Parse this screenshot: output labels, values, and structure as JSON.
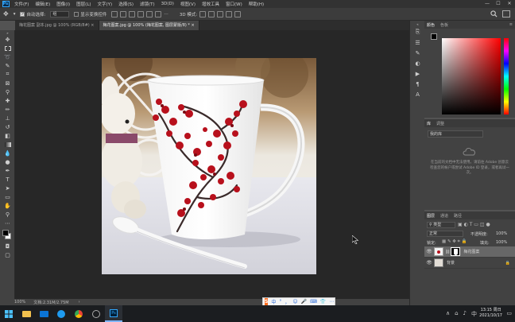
{
  "menubar": {
    "logo": "Ps",
    "items": [
      "文件(F)",
      "编辑(E)",
      "图像(I)",
      "图层(L)",
      "文字(Y)",
      "选择(S)",
      "滤镜(T)",
      "3D(D)",
      "视图(V)",
      "增效工具",
      "窗口(W)",
      "帮助(H)"
    ],
    "minimize": "—",
    "maximize": "☐",
    "close": "✕"
  },
  "optionsbar": {
    "auto_select_label": "自动选择:",
    "auto_select_value": "组",
    "show_transform_label": "显示变换控件",
    "mode_3d": "3D 模式:"
  },
  "tabs": [
    {
      "label": "梅花图案 副本.jpg @ 100% (RGB/8#) ×",
      "active": false
    },
    {
      "label": "梅花图案.jpg @ 100% (梅花图案, 图层蒙版/8) * ×",
      "active": true
    }
  ],
  "status": {
    "zoom": "100%",
    "doc": "文档:2.31M/2.75M",
    "arrow": "›"
  },
  "color_panel": {
    "tabs": [
      "颜色",
      "色板"
    ],
    "fg_color": "#000000",
    "bg_color": "#ffffff",
    "hue_base": "#ff0000"
  },
  "library_panel": {
    "tabs": [
      "库",
      "调整"
    ],
    "dropdown": "我的库",
    "message": "在当前的文档中无法使用。请前往 Adobe 创意云检查您的帐户或尝试 Adobe ID 登录，或者再试一次。"
  },
  "layers_panel": {
    "tabs": [
      "图层",
      "通道",
      "路径"
    ],
    "kind_label": "类型",
    "blend_mode": "正常",
    "opacity_label": "不透明度:",
    "opacity_value": "100%",
    "lock_label": "锁定:",
    "fill_label": "填充:",
    "fill_value": "100%",
    "layers": [
      {
        "name": "梅花图案",
        "selected": true,
        "has_mask": true
      },
      {
        "name": "背景",
        "selected": false,
        "has_mask": false
      }
    ]
  },
  "ime_bar": {
    "logo": "S",
    "items": [
      "中",
      "°",
      "，",
      "☺",
      "🎤",
      "⌨",
      "👕",
      "⋯"
    ]
  },
  "taskbar": {
    "time": "13:15",
    "weekday": "周日",
    "date": "2021/10/17",
    "lang": "中",
    "notify": "▭"
  }
}
